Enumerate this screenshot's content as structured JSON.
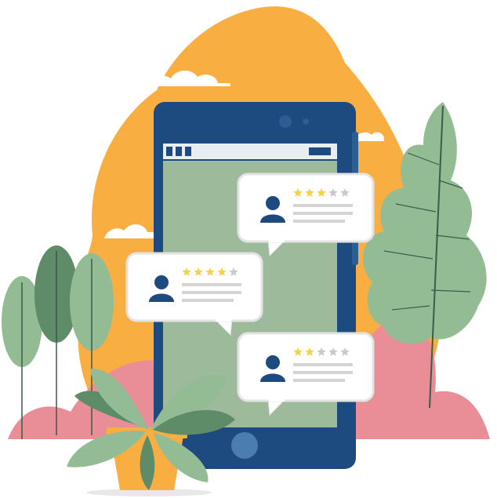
{
  "colors": {
    "blob": "#F9AE42",
    "phone_frame": "#1D4B7F",
    "phone_screen": "#9DBB9A",
    "bubble": "#FFFFFF",
    "bubble_border": "#E3E3E3",
    "avatar": "#1D4B7F",
    "star_on": "#F6D24B",
    "star_off": "#C9C9C9",
    "line": "#D4D4D4",
    "leaf_light": "#93BC94",
    "leaf_dark": "#5E8B68",
    "pink_hill": "#E98E97",
    "pot": "#F9AE42",
    "cloud": "#FFFFFF"
  },
  "reviews": [
    {
      "rating": 3,
      "max": 5
    },
    {
      "rating": 4,
      "max": 5
    },
    {
      "rating": 2,
      "max": 5
    }
  ],
  "icons": {
    "avatar": "user-avatar-icon",
    "star": "star-icon",
    "home_button": "home-button-icon",
    "camera": "camera-icon"
  }
}
